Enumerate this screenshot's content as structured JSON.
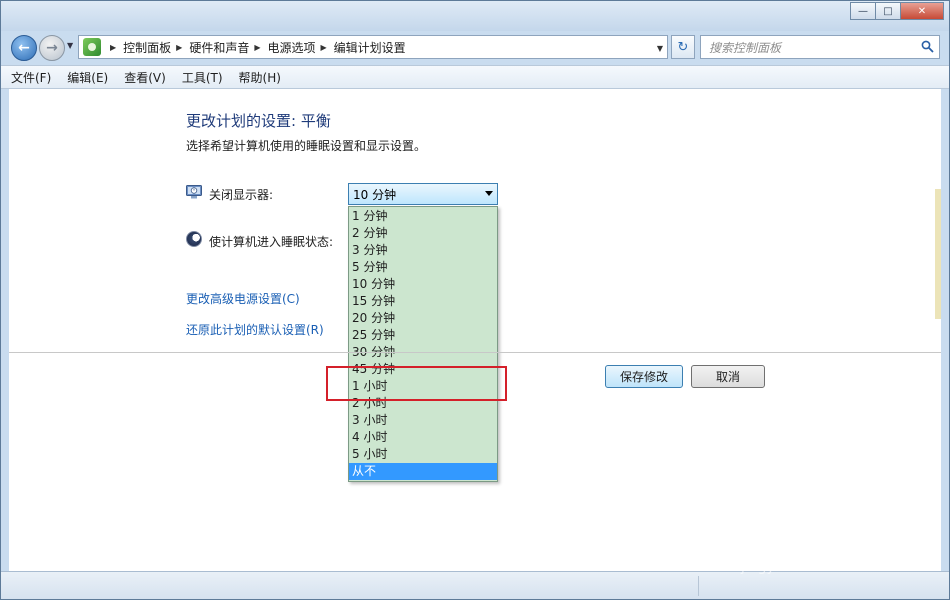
{
  "window": {
    "title_buttons": [
      "minimize-icon",
      "maximize-icon",
      "close-icon"
    ]
  },
  "address_bar": {
    "breadcrumbs": [
      "控制面板",
      "硬件和声音",
      "电源选项",
      "编辑计划设置"
    ]
  },
  "search": {
    "placeholder": "搜索控制面板"
  },
  "menu": {
    "items": [
      "文件(F)",
      "编辑(E)",
      "查看(V)",
      "工具(T)",
      "帮助(H)"
    ]
  },
  "page": {
    "title": "更改计划的设置: 平衡",
    "description": "选择希望计算机使用的睡眠设置和显示设置。",
    "display_off_label": "关闭显示器:",
    "sleep_label": "使计算机进入睡眠状态:",
    "display_off_value": "10 分钟",
    "dropdown_options": [
      "1 分钟",
      "2 分钟",
      "3 分钟",
      "5 分钟",
      "10 分钟",
      "15 分钟",
      "20 分钟",
      "25 分钟",
      "30 分钟",
      "45 分钟",
      "1 小时",
      "2 小时",
      "3 小时",
      "4 小时",
      "5 小时",
      "从不"
    ],
    "highlighted_option": "从不",
    "advanced_link": "更改高级电源设置(C)",
    "restore_link": "还原此计划的默认设置(R)",
    "save_button": "保存修改",
    "cancel_button": "取消"
  },
  "watermark": {
    "brand": "Baidu经验",
    "url": "jingyan.baidu.com"
  },
  "colors": {
    "link": "#1a5fb4",
    "title": "#1f3b7a",
    "highlight": "#3399ff",
    "annotation": "#d4202a",
    "dropdown_bg": "#cce6cf"
  }
}
